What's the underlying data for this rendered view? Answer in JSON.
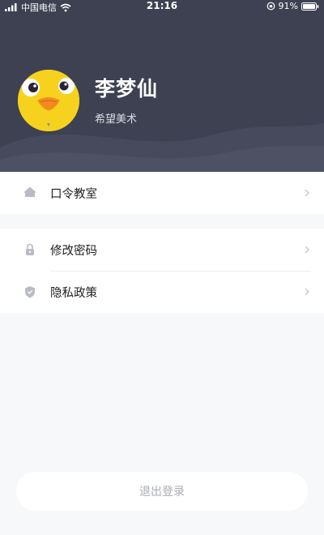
{
  "status_bar": {
    "carrier": "中国电信",
    "time": "21:16",
    "battery": "91%"
  },
  "profile": {
    "name": "李梦仙",
    "organization": "希望美术"
  },
  "menu": {
    "group1": [
      {
        "label": "口令教室",
        "icon": "home-icon"
      }
    ],
    "group2": [
      {
        "label": "修改密码",
        "icon": "lock-icon"
      },
      {
        "label": "隐私政策",
        "icon": "shield-icon"
      }
    ]
  },
  "logout_label": "退出登录",
  "colors": {
    "header_bg": "#3e4152",
    "avatar_bg": "#f6d21e",
    "page_bg": "#f7f8fa"
  }
}
